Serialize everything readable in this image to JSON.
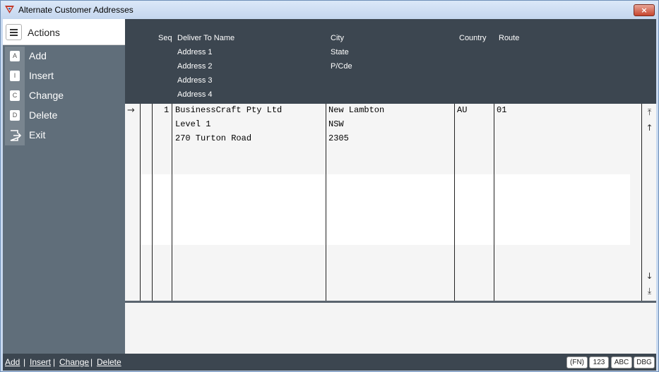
{
  "window": {
    "title": "Alternate Customer Addresses",
    "close_label": "×"
  },
  "sidebar": {
    "header": "Actions",
    "items": [
      {
        "key": "A",
        "label": "Add"
      },
      {
        "key": "I",
        "label": "Insert"
      },
      {
        "key": "C",
        "label": "Change"
      },
      {
        "key": "D",
        "label": "Delete"
      },
      {
        "key": "",
        "label": "Exit",
        "icon": "exit-icon"
      }
    ]
  },
  "grid": {
    "headers": {
      "seq": "Seq",
      "deliver_to_name": "Deliver To Name",
      "address1": "Address 1",
      "address2": "Address 2",
      "address3": "Address 3",
      "address4": "Address 4",
      "city": "City",
      "state": "State",
      "pcode": "P/Cde",
      "country": "Country",
      "route": "Route"
    },
    "rows": [
      {
        "seq": "1",
        "name": "BusinessCraft Pty Ltd",
        "address_line2": "Level 1",
        "address_line3": "270 Turton Road",
        "city": "New Lambton",
        "state": "NSW",
        "pcode": "2305",
        "country": "AU",
        "route": "01"
      }
    ],
    "row_pointer_icon": "arrow-right-icon",
    "scroll_icons": [
      "scroll-top-icon",
      "scroll-up-icon",
      "scroll-down-icon",
      "scroll-bottom-icon"
    ]
  },
  "statusbar": {
    "links": [
      "Add",
      "Insert",
      "Change",
      "Delete"
    ],
    "separator": "|",
    "buttons": [
      "(FN)",
      "123",
      "ABC",
      "DBG"
    ]
  }
}
